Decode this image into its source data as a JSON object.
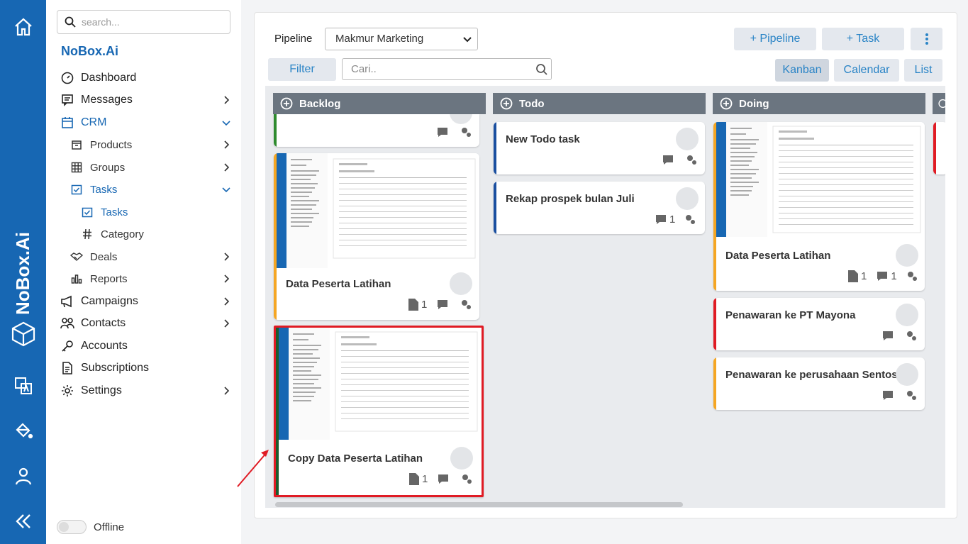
{
  "sidebar": {
    "search_placeholder": "search...",
    "brand": "NoBox.Ai",
    "rail_brand": "NoBox.Ai",
    "items": [
      {
        "label": "Dashboard",
        "icon": "gauge-icon"
      },
      {
        "label": "Messages",
        "icon": "message-icon"
      },
      {
        "label": "CRM",
        "icon": "calendar-icon"
      },
      {
        "label": "Products",
        "icon": "box-icon"
      },
      {
        "label": "Groups",
        "icon": "grid-icon"
      },
      {
        "label": "Tasks",
        "icon": "checkbox-icon"
      },
      {
        "label": "Tasks",
        "icon": "checkbox-icon"
      },
      {
        "label": "Category",
        "icon": "hash-icon"
      },
      {
        "label": "Deals",
        "icon": "handshake-icon"
      },
      {
        "label": "Reports",
        "icon": "chart-icon"
      },
      {
        "label": "Campaigns",
        "icon": "megaphone-icon"
      },
      {
        "label": "Contacts",
        "icon": "users-icon"
      },
      {
        "label": "Accounts",
        "icon": "key-icon"
      },
      {
        "label": "Subscriptions",
        "icon": "document-icon"
      },
      {
        "label": "Settings",
        "icon": "gear-icon"
      }
    ],
    "offline_label": "Offline"
  },
  "toolbar": {
    "pipeline_label": "Pipeline",
    "pipeline_value": "Makmur Marketing",
    "add_pipeline": "+ Pipeline",
    "add_task": "+ Task",
    "filter": "Filter",
    "search_placeholder": "Cari..",
    "views": [
      "Kanban",
      "Calendar",
      "List"
    ]
  },
  "columns": [
    {
      "title": "Backlog",
      "cards": [
        {
          "title": "Data Peserta Latihan",
          "attachments": "1"
        },
        {
          "title": "Copy Data Peserta Latihan",
          "attachments": "1"
        }
      ]
    },
    {
      "title": "Todo",
      "cards": [
        {
          "title": "New Todo task"
        },
        {
          "title": "Rekap prospek bulan Juli",
          "comments": "1"
        }
      ]
    },
    {
      "title": "Doing",
      "cards": [
        {
          "title": "Data Peserta Latihan",
          "attachments": "1",
          "comments": "1"
        },
        {
          "title": "Penawaran ke PT Mayona"
        },
        {
          "title": "Penawaran ke perusahaan Sentosa"
        }
      ]
    }
  ],
  "colors": {
    "primary": "#1767b3",
    "accent": "#2a84c6",
    "green": "#2e8b2e",
    "orange": "#f5a623",
    "red": "#e01b24",
    "blue": "#1a4fa0",
    "highlight": "#e01b24"
  }
}
